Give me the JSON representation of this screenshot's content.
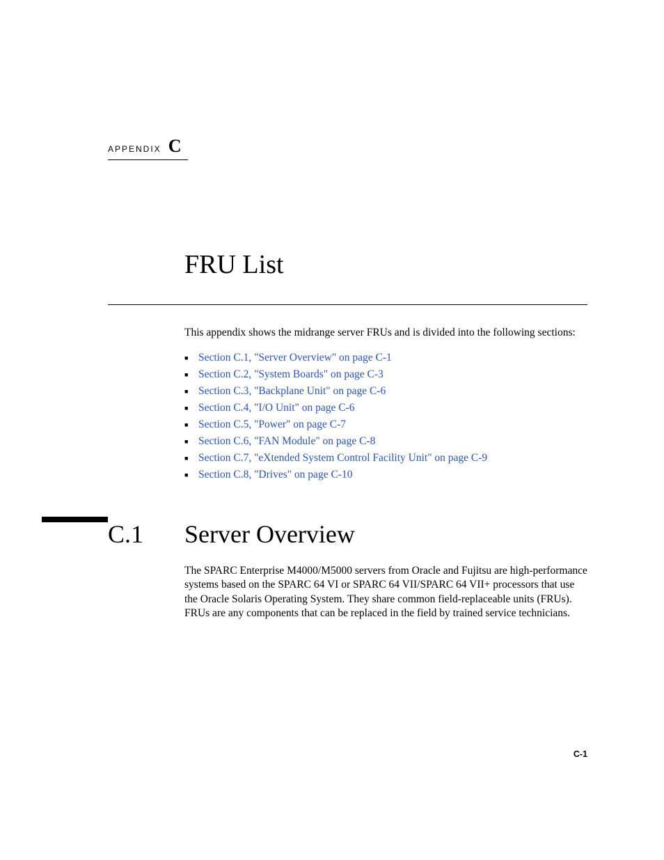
{
  "header": {
    "label": "APPENDIX",
    "letter": "C"
  },
  "title": "FRU List",
  "intro": "This appendix shows the midrange server FRUs and is divided into the following sections:",
  "toc": [
    "Section C.1, \"Server Overview\" on page C-1",
    "Section C.2, \"System Boards\" on page C-3",
    "Section C.3, \"Backplane Unit\" on page C-6",
    "Section C.4, \"I/O Unit\" on page C-6",
    "Section C.5, \"Power\" on page C-7",
    "Section C.6, \"FAN Module\" on page C-8",
    "Section C.7, \"eXtended System Control Facility Unit\" on page C-9",
    "Section C.8, \"Drives\" on page C-10"
  ],
  "section": {
    "number": "C.1",
    "title": "Server Overview",
    "body": "The SPARC Enterprise M4000/M5000 servers from Oracle and Fujitsu are high-performance systems based on the SPARC 64 VI or SPARC 64 VII/SPARC 64 VII+ processors that use the Oracle Solaris Operating System. They share common field-replaceable units (FRUs). FRUs are any components that can be replaced in the field by trained service technicians."
  },
  "pageNumber": "C-1"
}
